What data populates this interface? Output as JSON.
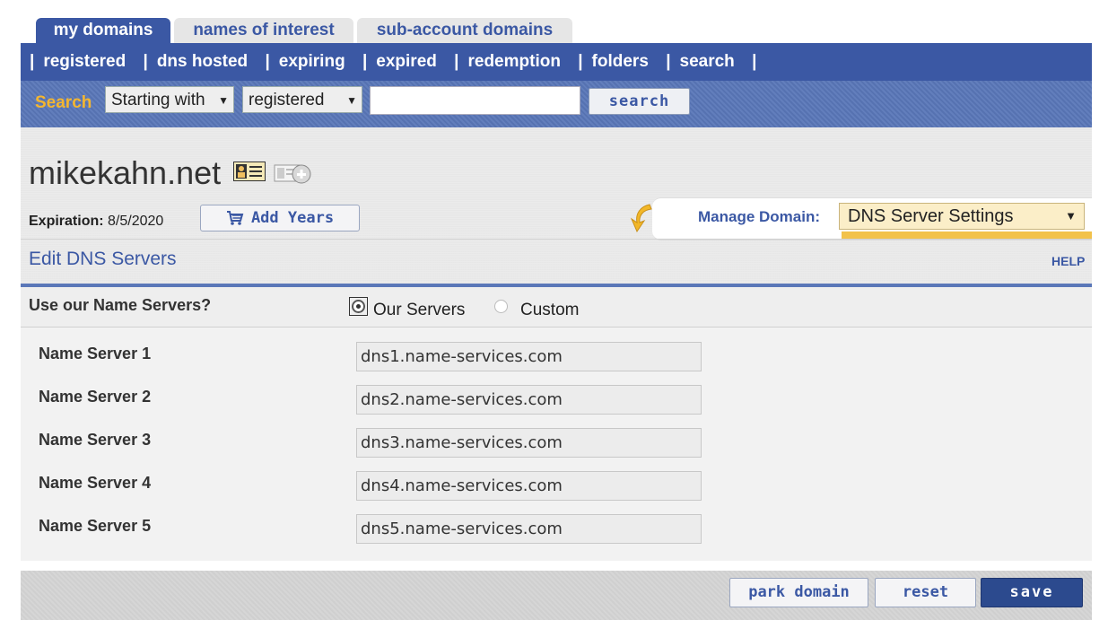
{
  "tabs": [
    {
      "label": "my domains",
      "active": true
    },
    {
      "label": "names of interest",
      "active": false
    },
    {
      "label": "sub-account domains",
      "active": false
    }
  ],
  "nav": {
    "separator": "|",
    "links": [
      "registered",
      "dns hosted",
      "expiring",
      "expired",
      "redemption",
      "folders",
      "search"
    ]
  },
  "search": {
    "label": "Search",
    "mode": "Starting with",
    "scope": "registered",
    "query": "",
    "button": "search"
  },
  "domain": {
    "name": "mikekahn.net",
    "expiration_label": "Expiration:",
    "expiration_date": "8/5/2020",
    "add_years_label": "Add Years",
    "manage_label": "Manage Domain:",
    "manage_selected": "DNS Server Settings"
  },
  "section": {
    "title": "Edit DNS Servers",
    "help": "HELP"
  },
  "use_ns": {
    "label": "Use our Name Servers?",
    "options": [
      "Our Servers",
      "Custom"
    ],
    "selected": "Our Servers"
  },
  "name_servers": [
    {
      "label": "Name Server 1",
      "value": "dns1.name-services.com"
    },
    {
      "label": "Name Server 2",
      "value": "dns2.name-services.com"
    },
    {
      "label": "Name Server 3",
      "value": "dns3.name-services.com"
    },
    {
      "label": "Name Server 4",
      "value": "dns4.name-services.com"
    },
    {
      "label": "Name Server 5",
      "value": "dns5.name-services.com"
    }
  ],
  "buttons": {
    "park": "park domain",
    "reset": "reset",
    "save": "save"
  },
  "colors": {
    "primary": "#3b58a4",
    "accent": "#f4b630",
    "save": "#2c4a8e"
  },
  "icons": {
    "card": "contact-card-icon",
    "camera": "add-photo-icon",
    "cart": "cart-icon",
    "manage_arrow": "curved-arrow-icon"
  }
}
